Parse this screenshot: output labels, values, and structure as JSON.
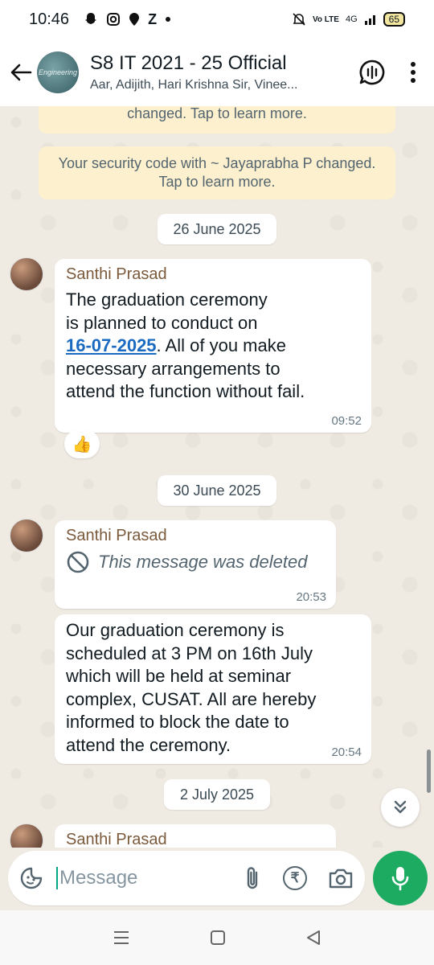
{
  "status_bar": {
    "time": "10:46",
    "left_icons": [
      "snapchat-icon",
      "instagram-icon",
      "swiggy-icon",
      "zomato-icon",
      "dot-icon"
    ],
    "zomato_glyph": "Z",
    "network_label": "Vo LTE",
    "network_type": "4G",
    "battery": "65"
  },
  "header": {
    "group_avatar_text": "Engineering",
    "title": "S8 IT 2021 - 25 Official",
    "subtitle": "Aar, Adijith, Hari Krishna Sir, Vinee..."
  },
  "chat": {
    "system_messages": [
      {
        "text": "changed. Tap to learn more."
      },
      {
        "text": "Your security code with ~ Jayaprabha P changed. Tap to learn more."
      }
    ],
    "dates": [
      "26 June 2025",
      "30 June 2025",
      "2 July 2025"
    ],
    "messages": [
      {
        "sender": "Santhi Prasad",
        "text_before": "The graduation ceremony\nis planned to conduct on\n",
        "link": "16-07-2025",
        "text_after": ". All of you make\nnecessary arrangements to\nattend the  function without fail.",
        "time": "09:52",
        "reaction": "👍"
      },
      {
        "sender": "Santhi Prasad",
        "deleted_text": "This message was deleted",
        "time": "20:53"
      },
      {
        "text": "Our graduation ceremony is\nscheduled at 3 PM on 16th July\nwhich will be held at seminar\ncomplex, CUSAT. All are hereby\ninformed to block the date to\nattend the ceremony.",
        "time": "20:54"
      },
      {
        "sender": "Santhi Prasad"
      }
    ]
  },
  "composer": {
    "placeholder": "Message",
    "currency_symbol": "₹"
  },
  "colors": {
    "chat_bg": "#efeae2",
    "system_bg": "#fcf0cf",
    "sender_name": "#7b5a3c",
    "link": "#1b6ac1",
    "mic_button": "#1daa61"
  }
}
